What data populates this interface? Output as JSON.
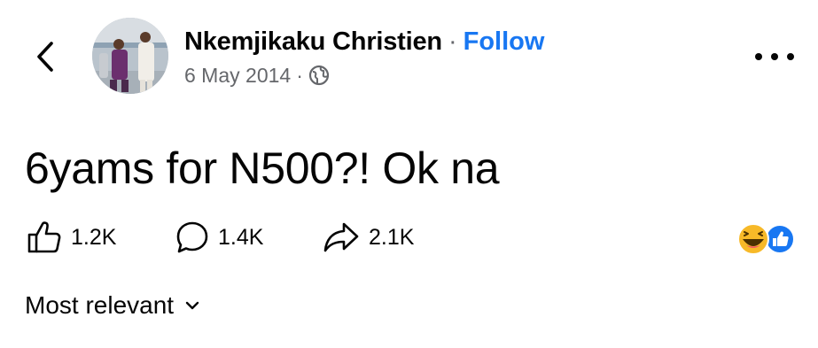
{
  "header": {
    "author_name": "Nkemjikaku Christien",
    "separator": "·",
    "follow_label": "Follow",
    "post_date": "6 May 2014",
    "meta_separator": "·",
    "privacy_icon": "globe-icon",
    "back_icon": "chevron-left-icon",
    "more_icon": "more-horizontal-icon"
  },
  "post": {
    "text": "6yams for N500?! Ok na"
  },
  "actions": {
    "like_count": "1.2K",
    "comment_count": "1.4K",
    "share_count": "2.1K"
  },
  "reactions": [
    "haha",
    "like"
  ],
  "comments": {
    "sort_label": "Most relevant"
  },
  "colors": {
    "accent": "#1877f2",
    "secondary_text": "#65676b",
    "primary_text": "#050505",
    "haha_yellow": "#f7b928"
  }
}
